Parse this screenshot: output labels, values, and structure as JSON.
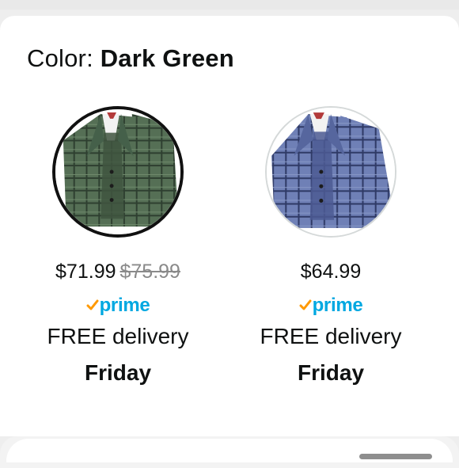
{
  "color_selector": {
    "label": "Color: ",
    "selected_value": "Dark Green"
  },
  "options": [
    {
      "name": "Dark Green",
      "selected": true,
      "price": "$71.99",
      "list_price": "$75.99",
      "prime_label": "prime",
      "delivery": "FREE delivery",
      "day": "Friday",
      "swatch_color": "#4d6a4f"
    },
    {
      "name": "Blue",
      "selected": false,
      "price": "$64.99",
      "prime_label": "prime",
      "delivery": "FREE delivery",
      "day": "Friday",
      "swatch_color": "#5a6fa6"
    }
  ],
  "colors": {
    "prime_blue": "#00a8e1",
    "prime_check": "#ff9900",
    "selected_ring": "#111111",
    "strike_price": "#8a8a8a"
  }
}
